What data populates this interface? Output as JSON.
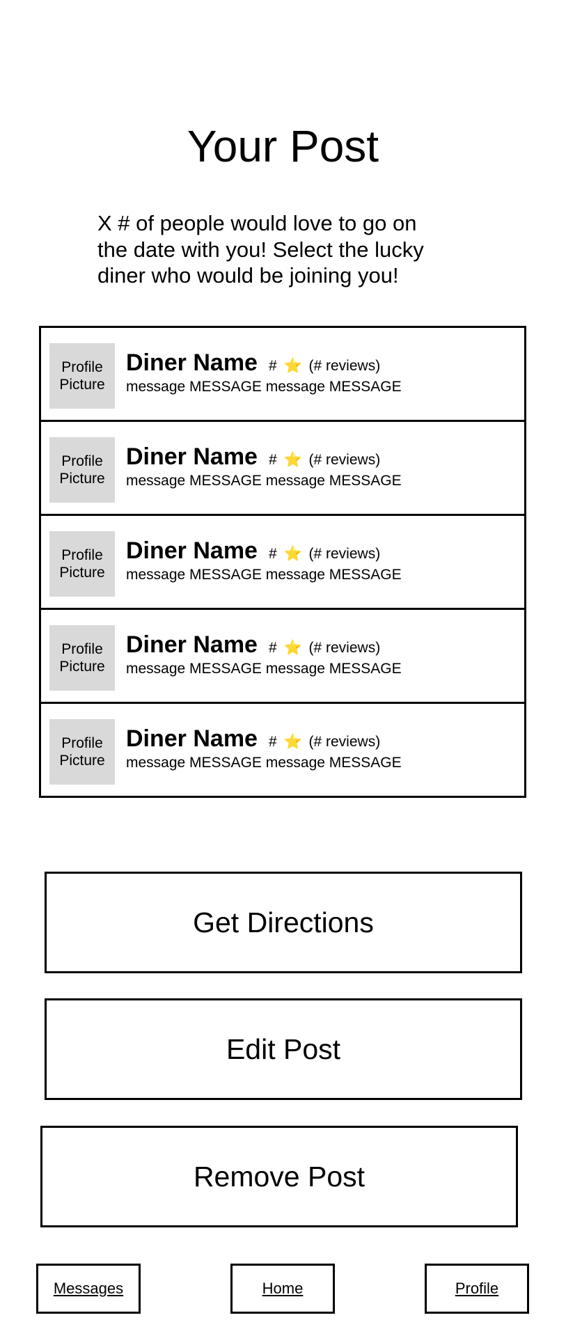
{
  "page": {
    "title": "Your Post",
    "intro": "X # of people would love to go on\nthe date with you!  Select the lucky\ndiner who would be joining you!"
  },
  "diners": [
    {
      "avatar_label": "Profile\nPicture",
      "name": "Diner Name",
      "rating_prefix": "#",
      "star": "⭐",
      "reviews": "(# reviews)",
      "message": "message MESSAGE message MESSAGE"
    },
    {
      "avatar_label": "Profile\nPicture",
      "name": "Diner Name",
      "rating_prefix": "#",
      "star": "⭐",
      "reviews": "(# reviews)",
      "message": "message MESSAGE message MESSAGE"
    },
    {
      "avatar_label": "Profile\nPicture",
      "name": "Diner Name",
      "rating_prefix": "#",
      "star": "⭐",
      "reviews": "(# reviews)",
      "message": "message MESSAGE message MESSAGE"
    },
    {
      "avatar_label": "Profile\nPicture",
      "name": "Diner Name",
      "rating_prefix": "#",
      "star": "⭐",
      "reviews": "(# reviews)",
      "message": "message MESSAGE message MESSAGE"
    },
    {
      "avatar_label": "Profile\nPicture",
      "name": "Diner Name",
      "rating_prefix": "#",
      "star": "⭐",
      "reviews": "(# reviews)",
      "message": "message MESSAGE message MESSAGE"
    }
  ],
  "actions": {
    "directions_label": "Get Directions",
    "edit_label": "Edit Post",
    "remove_label": "Remove Post"
  },
  "nav": {
    "messages_label": "Messages",
    "home_label": "Home",
    "profile_label": "Profile"
  },
  "colors": {
    "avatar_placeholder": "#d9d9d9",
    "border": "#000000",
    "star": "#f5c518"
  },
  "icons": {
    "rating": "star-icon"
  }
}
